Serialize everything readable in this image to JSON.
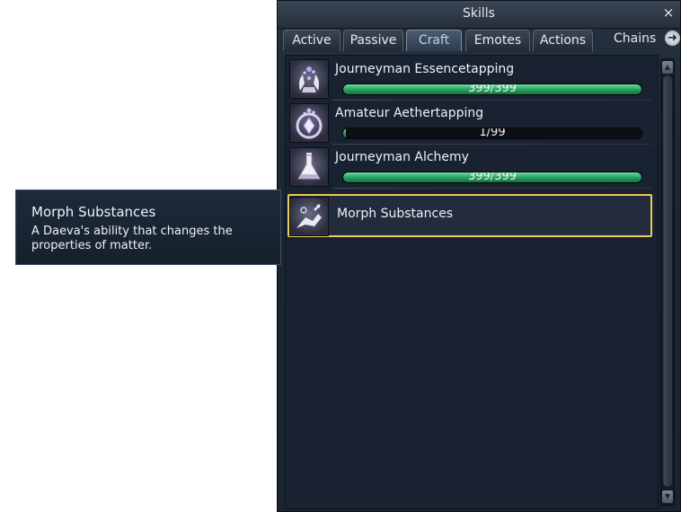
{
  "window": {
    "title": "Skills",
    "close_icon": "×"
  },
  "tabs": [
    {
      "label": "Active",
      "active": false
    },
    {
      "label": "Passive",
      "active": false
    },
    {
      "label": "Craft",
      "active": true
    },
    {
      "label": "Emotes",
      "active": false
    },
    {
      "label": "Actions",
      "active": false
    }
  ],
  "chains": {
    "label": "Chains",
    "icon": "arrow-right-icon",
    "glyph": "➜"
  },
  "skills": [
    {
      "name": "Journeyman Essencetapping",
      "progress_text": "399/399",
      "progress": 1.0,
      "icon": "hands-essence-icon"
    },
    {
      "name": "Amateur Aethertapping",
      "progress_text": "1/99",
      "progress": 0.0101,
      "icon": "aether-crystal-icon"
    },
    {
      "name": "Journeyman Alchemy",
      "progress_text": "399/399",
      "progress": 1.0,
      "icon": "alchemy-flask-icon"
    },
    {
      "name": "Morph Substances",
      "icon": "morph-hand-icon",
      "selected": true
    }
  ],
  "scrollbar": {
    "up": "▲",
    "down": "▼"
  },
  "tooltip": {
    "title": "Morph Substances",
    "description": "A Daeva's ability that changes the properties of matter."
  },
  "colors": {
    "progress_fill": "#27a262",
    "selection_border": "#e9cb58",
    "active_tab_text": "#b7d3f2"
  }
}
